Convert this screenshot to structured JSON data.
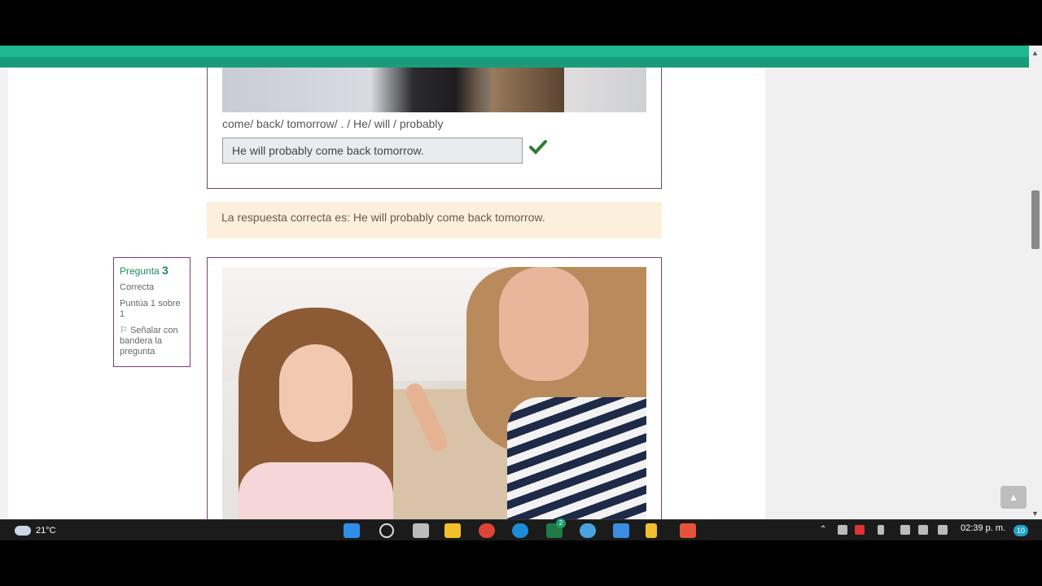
{
  "question2": {
    "prompt": "come/ back/ tomorrow/ . / He/ will / probably",
    "answer": "He will probably come back tomorrow.",
    "feedback": "La respuesta correcta es: He will probably come back tomorrow."
  },
  "question3": {
    "label": "Pregunta",
    "number": "3",
    "status": "Correcta",
    "score": "Puntúa 1 sobre 1",
    "flag": "Señalar con bandera la pregunta"
  },
  "colors": {
    "brand": "#1fb891",
    "border": "#7a3e7a",
    "feedback_bg": "#fcefdc",
    "check": "#2e7d32"
  },
  "icons": {
    "check": "check-icon",
    "flag": "flag-icon",
    "to_top": "chevron-up-icon"
  },
  "taskbar": {
    "temperature": "21°C",
    "time": "02:39 p. m.",
    "notifications": "10",
    "excel_badge": "2"
  }
}
